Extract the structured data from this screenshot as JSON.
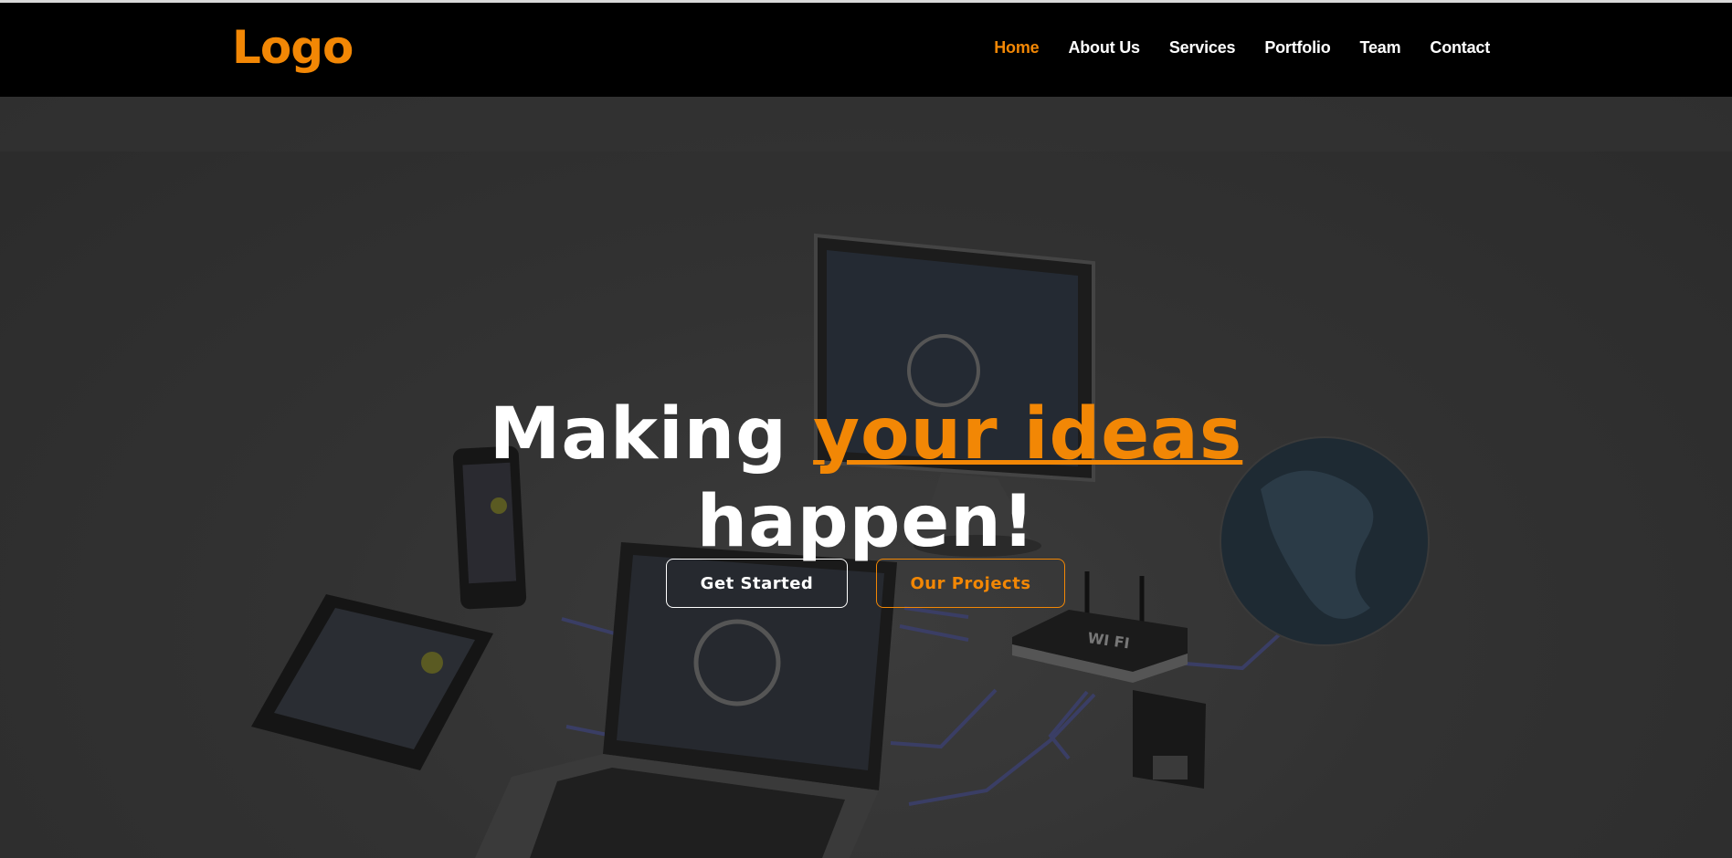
{
  "header": {
    "logo": "Logo",
    "nav": [
      {
        "label": "Home",
        "active": true
      },
      {
        "label": "About Us",
        "active": false
      },
      {
        "label": "Services",
        "active": false
      },
      {
        "label": "Portfolio",
        "active": false
      },
      {
        "label": "Team",
        "active": false
      },
      {
        "label": "Contact",
        "active": false
      }
    ]
  },
  "hero": {
    "title_part1": "Making",
    "title_accent": "your ideas",
    "title_part2": "happen!",
    "primary_button": "Get Started",
    "secondary_button": "Our Projects",
    "background_image": "connected-devices-image",
    "router_label": "WI FI"
  },
  "colors": {
    "accent": "#f28705",
    "navbar_bg": "#000000",
    "hero_overlay": "#2d2d2d",
    "text": "#ffffff"
  }
}
